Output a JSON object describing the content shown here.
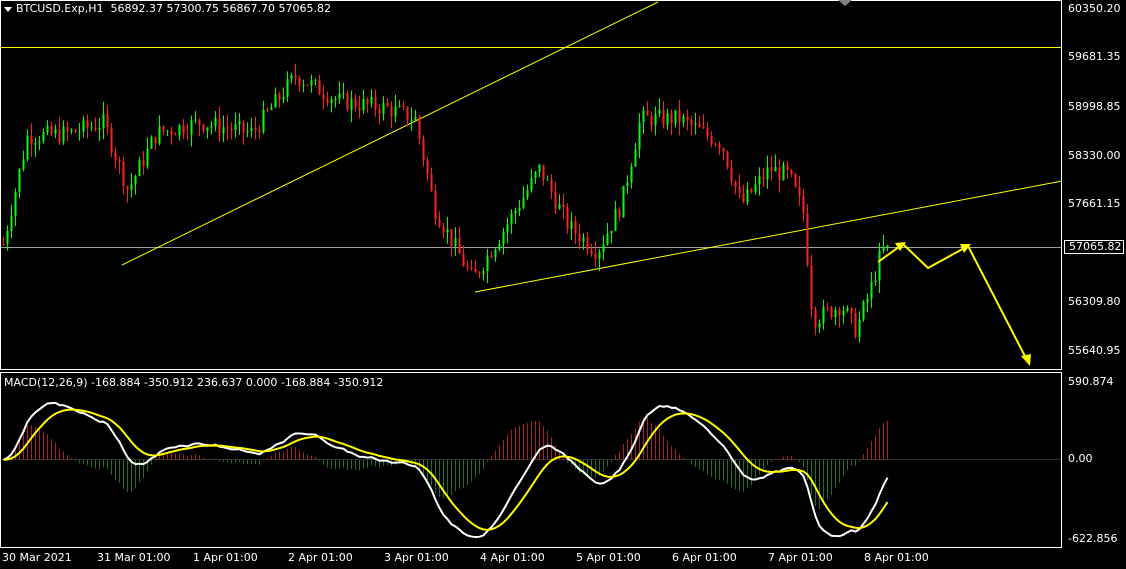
{
  "window": {
    "symbol": "BTCUSD.Exp,H1",
    "ohlc": "56892.37 57300.75 56867.70 57065.82"
  },
  "price_axis": {
    "labels": [
      "60350.20",
      "59681.35",
      "58998.85",
      "58330.00",
      "57661.15",
      "56309.80",
      "55640.95"
    ],
    "current_price": "57065.82"
  },
  "macd": {
    "header": "MACD(12,26,9) -168.884 -350.912 236.637 0.000 -168.884 -350.912",
    "axis_labels": [
      "590.874",
      "0.00",
      "-622.856"
    ]
  },
  "time_axis": {
    "labels": [
      "30 Mar 2021",
      "31 Mar 01:00",
      "1 Apr 01:00",
      "2 Apr 01:00",
      "3 Apr 01:00",
      "4 Apr 01:00",
      "5 Apr 01:00",
      "6 Apr 01:00",
      "7 Apr 01:00",
      "8 Apr 01:00"
    ]
  },
  "colors": {
    "background": "#000000",
    "bull": "#00ff00",
    "bear": "#ff2020",
    "trendline": "#ffff00",
    "macd_line": "#ffffff",
    "signal_line": "#ffff00",
    "hist_pos": "#b02020",
    "hist_neg": "#207020"
  },
  "chart_data": {
    "type": "candlestick",
    "symbol": "BTCUSD.Exp",
    "timeframe": "H1",
    "ylim": [
      55450,
      60500
    ],
    "key_points": [
      {
        "x": "30 Mar 2021",
        "y": 57150
      },
      {
        "x": "31 Mar 01:00",
        "y": 58800
      },
      {
        "x": "1 Apr 01:00",
        "y": 58850
      },
      {
        "x": "2 Apr 01:00",
        "y": 59500
      },
      {
        "x": "3 Apr 01:00",
        "y": 59050
      },
      {
        "x": "4 Apr 01:00",
        "y": 56650
      },
      {
        "x": "5 Apr 01:00",
        "y": 57050
      },
      {
        "x": "6 Apr 01:00",
        "y": 58900
      },
      {
        "x": "7 Apr 01:00",
        "y": 57900
      },
      {
        "x": "8 Apr 01:00",
        "y": 57065.82
      }
    ],
    "horizontal_levels": [
      59800,
      57065.82
    ],
    "macd": {
      "params": "12,26,9",
      "main": -168.884,
      "signal": -350.912,
      "ylim": [
        -622.856,
        590.874
      ]
    }
  }
}
